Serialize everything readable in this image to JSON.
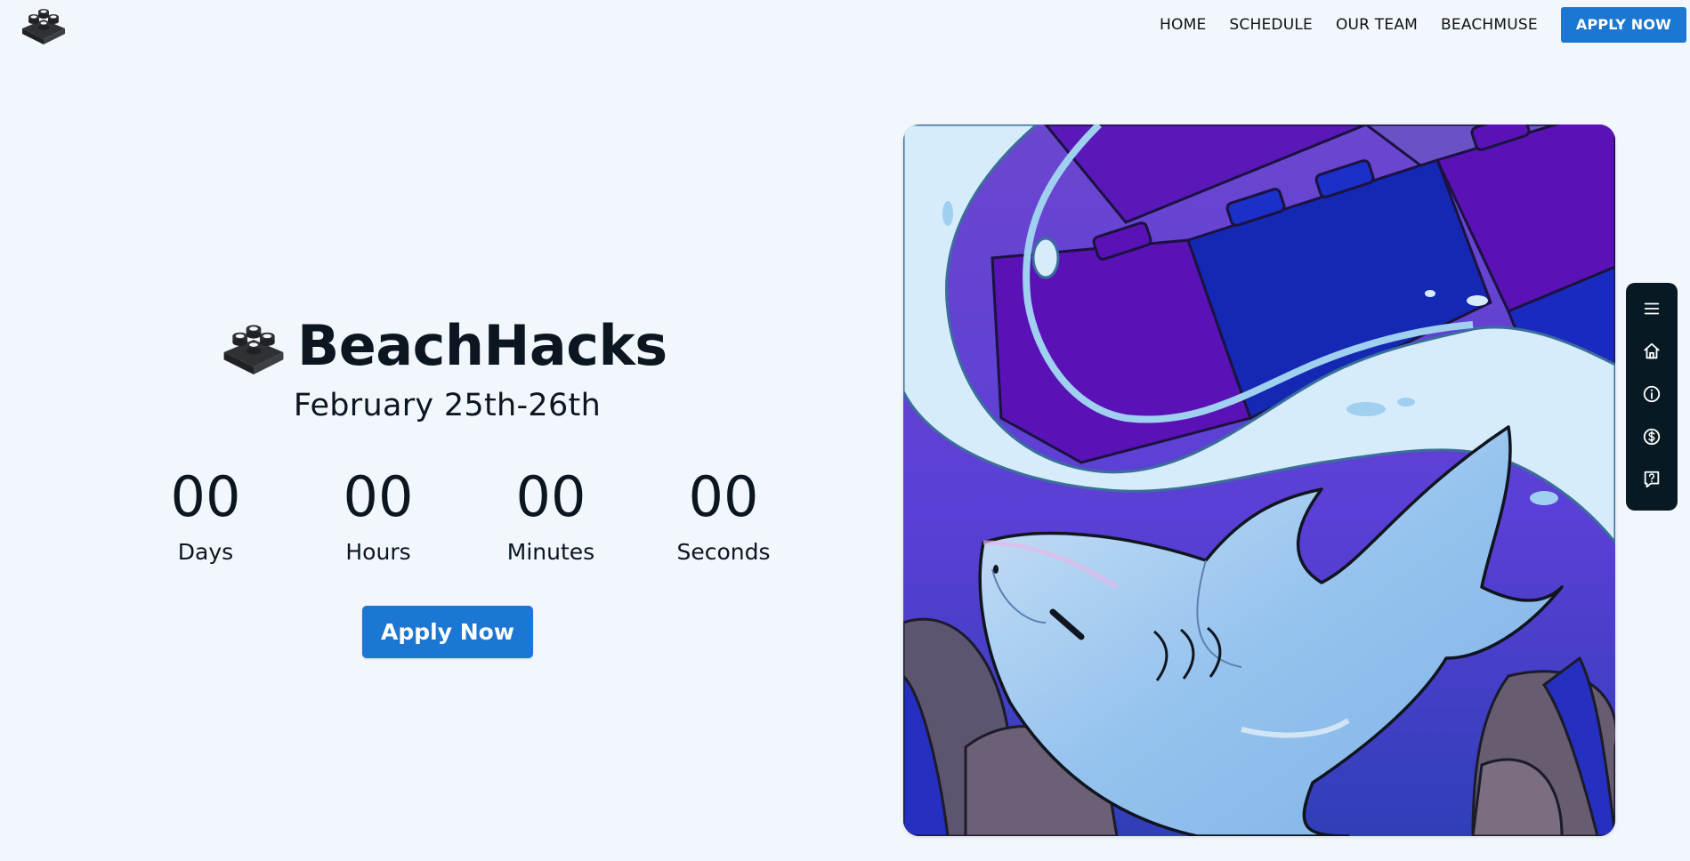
{
  "nav": {
    "logo_icon": "lego-brick-icon",
    "links": [
      "HOME",
      "SCHEDULE",
      "OUR TEAM",
      "BEACHMUSE"
    ],
    "apply_label": "APPLY NOW"
  },
  "hero": {
    "brand_icon": "lego-brick-icon",
    "title": "BeachHacks",
    "dates": "February 25th-26th",
    "countdown": [
      {
        "value": "00",
        "label": "Days"
      },
      {
        "value": "00",
        "label": "Hours"
      },
      {
        "value": "00",
        "label": "Minutes"
      },
      {
        "value": "00",
        "label": "Seconds"
      }
    ],
    "apply_label": "Apply Now",
    "illustration": "shark-swimming-through-lego-wave-illustration"
  },
  "dock": {
    "items": [
      "menu-icon",
      "home-icon",
      "info-icon",
      "dollar-icon",
      "faq-icon"
    ]
  },
  "colors": {
    "background": "#f2f7fd",
    "accent": "#1c77d2",
    "text": "#0b1620",
    "dock": "#071a23"
  }
}
